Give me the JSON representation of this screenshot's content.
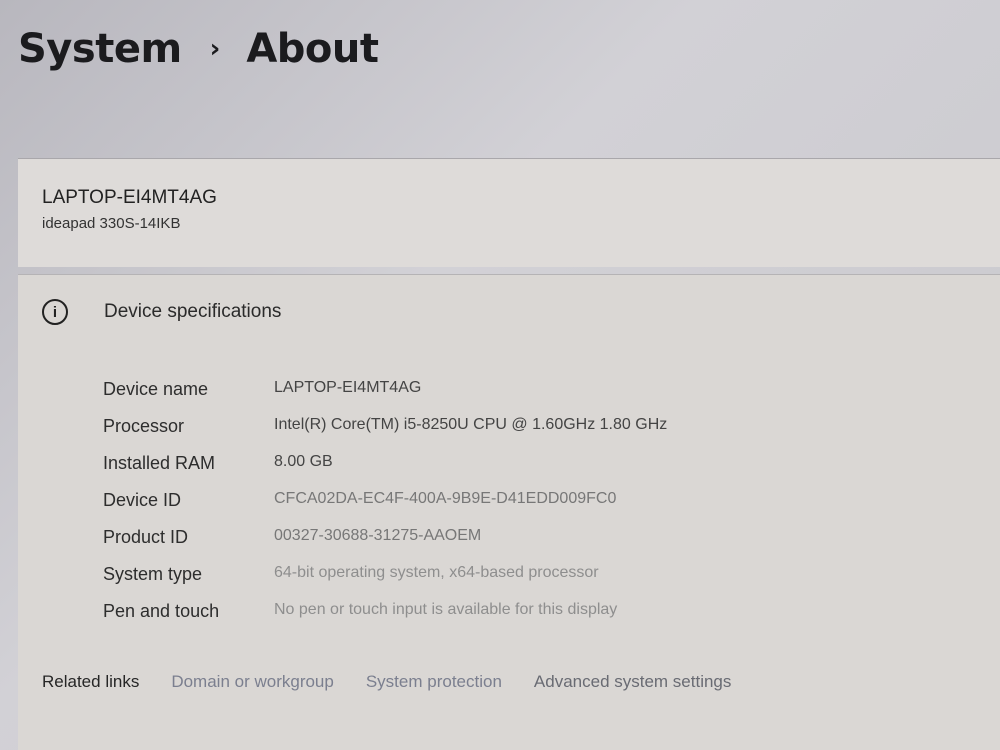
{
  "breadcrumb": {
    "parent": "System",
    "separator": "›",
    "current": "About"
  },
  "device": {
    "name": "LAPTOP-EI4MT4AG",
    "model": "ideapad 330S-14IKB"
  },
  "specs": {
    "icon": "info-icon",
    "icon_glyph": "i",
    "title": "Device specifications",
    "rows": [
      {
        "label": "Device name",
        "value": "LAPTOP-EI4MT4AG"
      },
      {
        "label": "Processor",
        "value": "Intel(R) Core(TM) i5-8250U CPU @ 1.60GHz   1.80 GHz"
      },
      {
        "label": "Installed RAM",
        "value": "8.00 GB"
      },
      {
        "label": "Device ID",
        "value": "CFCA02DA-EC4F-400A-9B9E-D41EDD009FC0"
      },
      {
        "label": "Product ID",
        "value": "00327-30688-31275-AAOEM"
      },
      {
        "label": "System type",
        "value": "64-bit operating system, x64-based processor"
      },
      {
        "label": "Pen and touch",
        "value": "No pen or touch input is available for this display"
      }
    ]
  },
  "related": {
    "label": "Related links",
    "links": [
      "Domain or workgroup",
      "System protection",
      "Advanced system settings"
    ]
  }
}
